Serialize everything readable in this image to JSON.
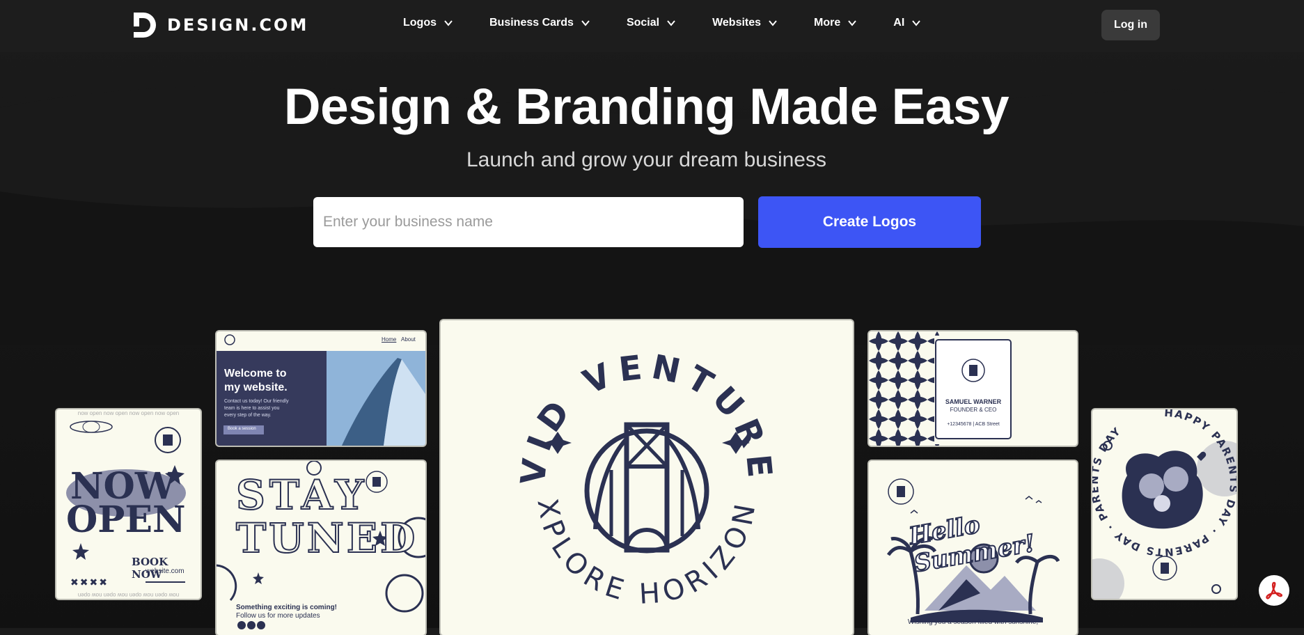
{
  "brand": {
    "name": "DESIGN.COM"
  },
  "nav": {
    "items": [
      {
        "label": "Logos"
      },
      {
        "label": "Business Cards"
      },
      {
        "label": "Social"
      },
      {
        "label": "Websites"
      },
      {
        "label": "More"
      },
      {
        "label": "AI"
      }
    ],
    "login_label": "Log in"
  },
  "hero": {
    "title": "Design & Branding Made Easy",
    "subtitle": "Launch and grow your dream business",
    "input_placeholder": "Enter your business name",
    "cta_label": "Create Logos"
  },
  "cards": {
    "now_open": {
      "headline_1": "NOW",
      "headline_2": "OPEN",
      "book": "BOOK NOW",
      "site": "website.com",
      "marks": "✖✖✖✖",
      "border_text": "now open now open now open now open"
    },
    "website": {
      "nav_home": "Home",
      "nav_about": "About",
      "heading_1": "Welcome to",
      "heading_2": "my website.",
      "body_1": "Contact us today! Our friendly",
      "body_2": "team is here to assist you",
      "body_3": "every step of the way.",
      "button": "Book a session"
    },
    "stay_tuned": {
      "word_1": "STAY",
      "word_2": "TUNED",
      "line_1": "Something exciting is coming!",
      "line_2": "Follow us for more updates"
    },
    "avid": {
      "top_text": "AVID VENTURES",
      "bottom_text": "EXPLORE HORIZONS"
    },
    "business_card": {
      "name": "SAMUEL WARNER",
      "role": "FOUNDER & CEO",
      "contact": "+12345678 | ACB Street"
    },
    "summer": {
      "script": "Hello Summer!",
      "footer": "Wishing you a season filled with sunshine,"
    },
    "parents": {
      "ring_text": "HAPPY PARENTS DAY · PARENTS DAY · PARENTS DAY"
    },
    "mini_logo_top": "AVID VENTURES",
    "mini_logo_bottom": "EXPLORE HORIZONS"
  },
  "colors": {
    "accent": "#3d55f5",
    "navy": "#2b3152",
    "cream": "#fafaee",
    "background": "#161616"
  },
  "icons": [
    "design-logo-icon",
    "chevron-down-icon",
    "pdf-icon"
  ]
}
